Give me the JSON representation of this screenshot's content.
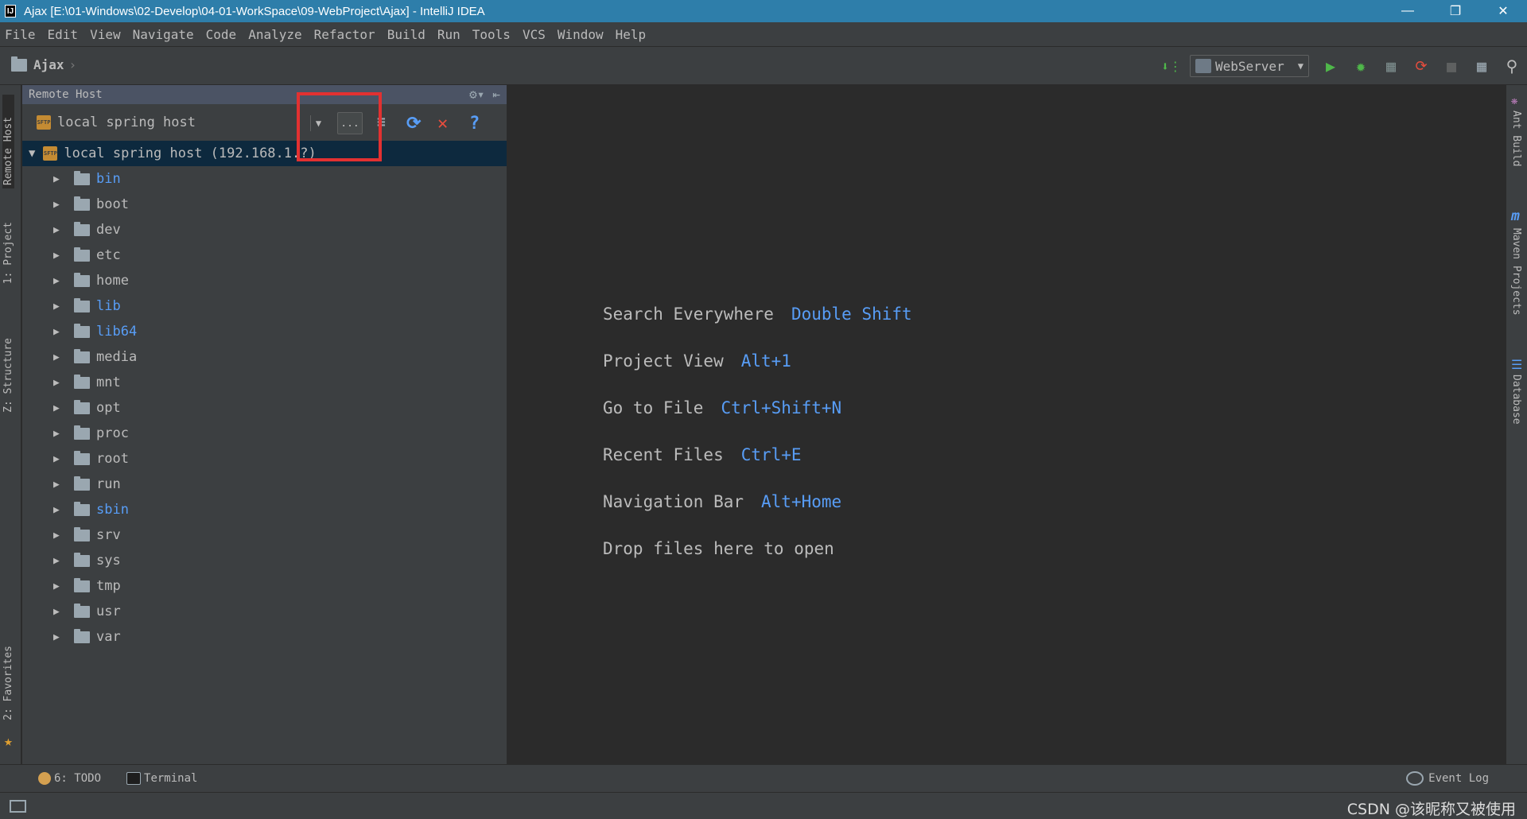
{
  "window": {
    "title": "Ajax [E:\\01-Windows\\02-Develop\\04-01-WorkSpace\\09-WebProject\\Ajax] - IntelliJ IDEA",
    "app_icon": "IJ"
  },
  "menu": [
    "File",
    "Edit",
    "View",
    "Navigate",
    "Code",
    "Analyze",
    "Refactor",
    "Build",
    "Run",
    "Tools",
    "VCS",
    "Window",
    "Help"
  ],
  "navbar": {
    "breadcrumb": "Ajax",
    "run_config": "WebServer"
  },
  "left_stripe": {
    "remote_host": "Remote Host",
    "project": "1: Project",
    "structure": "Z: Structure",
    "favorites": "2: Favorites"
  },
  "right_stripe": {
    "ant_build": "Ant Build",
    "maven": "Maven Projects",
    "database": "Database"
  },
  "remote_panel": {
    "header": "Remote Host",
    "selected_host": "local spring host",
    "dots_label": "...",
    "root": "local spring host (192.168.1.",
    "root_suffix": "?)",
    "folders": [
      {
        "name": "bin",
        "link": true
      },
      {
        "name": "boot",
        "link": false
      },
      {
        "name": "dev",
        "link": false
      },
      {
        "name": "etc",
        "link": false
      },
      {
        "name": "home",
        "link": false
      },
      {
        "name": "lib",
        "link": true
      },
      {
        "name": "lib64",
        "link": true
      },
      {
        "name": "media",
        "link": false
      },
      {
        "name": "mnt",
        "link": false
      },
      {
        "name": "opt",
        "link": false
      },
      {
        "name": "proc",
        "link": false
      },
      {
        "name": "root",
        "link": false
      },
      {
        "name": "run",
        "link": false
      },
      {
        "name": "sbin",
        "link": true
      },
      {
        "name": "srv",
        "link": false
      },
      {
        "name": "sys",
        "link": false
      },
      {
        "name": "tmp",
        "link": false
      },
      {
        "name": "usr",
        "link": false
      },
      {
        "name": "var",
        "link": false
      }
    ]
  },
  "editor_hints": [
    {
      "text": "Search Everywhere",
      "key": "Double Shift"
    },
    {
      "text": "Project View",
      "key": "Alt+1"
    },
    {
      "text": "Go to File",
      "key": "Ctrl+Shift+N"
    },
    {
      "text": "Recent Files",
      "key": "Ctrl+E"
    },
    {
      "text": "Navigation Bar",
      "key": "Alt+Home"
    },
    {
      "text": "Drop files here to open",
      "key": ""
    }
  ],
  "bottom": {
    "todo": "6: TODO",
    "terminal": "Terminal",
    "event_log": "Event Log"
  },
  "watermark": "CSDN @该昵称又被使用",
  "colors": {
    "titlebar": "#2e7eaa",
    "link": "#589df6",
    "highlight": "#e23131",
    "run_green": "#4fb84a",
    "close_red": "#e84d3d"
  }
}
